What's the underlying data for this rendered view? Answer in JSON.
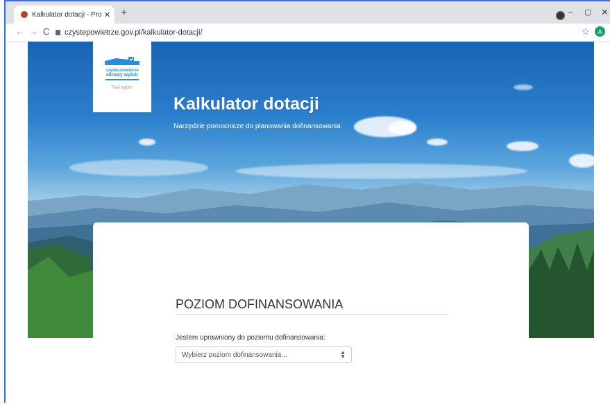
{
  "browser": {
    "tab_title": "Kalkulator dotacji - Program Czy",
    "tab_close": "✕",
    "new_tab": "+",
    "url": "czystepowietrze.gov.pl/kalkulator-dotacji/",
    "profile_initial": "A",
    "nav_back": "←",
    "nav_forward": "→",
    "nav_reload": "C",
    "star": "☆",
    "menu": "⋮",
    "win_minimize": "−",
    "win_restore": "▢",
    "win_close": "✕"
  },
  "logo": {
    "line1": "czyste powietrze",
    "line2": "zdrowy wybór",
    "tagline": "Twój wybór!"
  },
  "hero": {
    "title": "Kalkulator dotacji",
    "subtitle": "Narzędzie pomocnicze do planowania dofinansowania"
  },
  "form": {
    "section_title": "POZIOM DOFINANSOWANIA",
    "field_label": "Jestem uprawniony do poziomu dofinansowania:",
    "select_placeholder": "Wybierz poziom dofinansowania..."
  },
  "colors": {
    "accent": "#2a8fd0",
    "frame": "#3b6fd8",
    "profile": "#1a9e6e"
  }
}
